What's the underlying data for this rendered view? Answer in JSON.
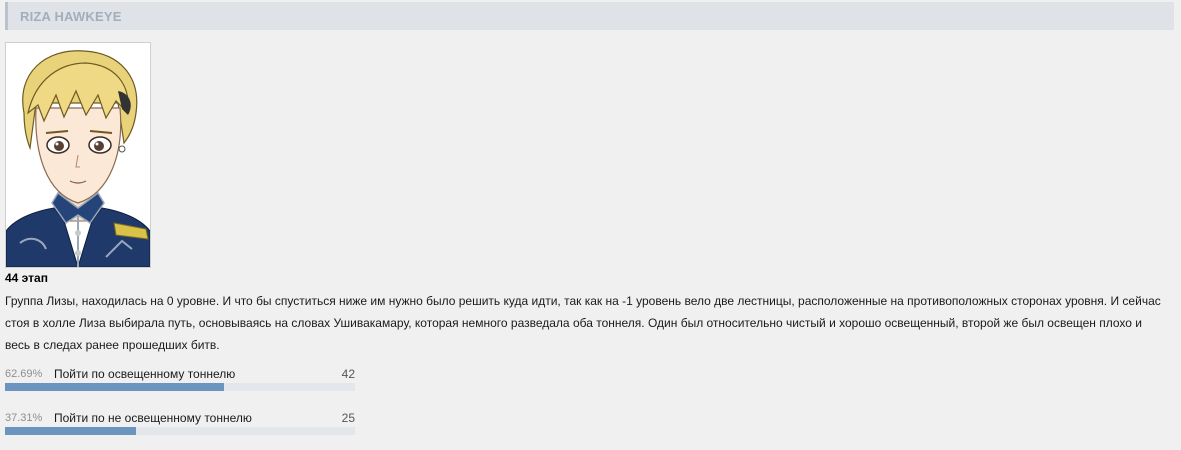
{
  "header": {
    "title": "RIZA HAWKEYE"
  },
  "post": {
    "stage": "44 этап",
    "description": "Группа Лизы, находилась на 0 уровне. И что бы спуститься ниже им нужно было решить куда идти, так как на -1 уровень вело две лестницы, расположенные на противоположных сторонах уровня. И сейчас стоя в холле Лиза выбирала путь, основываясь на словах Ушивакамару, которая немного разведала оба тоннеля. Один был относительно чистый и хорошо освещенный, второй же был освещен плохо и весь в следах ранее прошедших битв."
  },
  "poll": {
    "bar_color": "#6b95bf",
    "options": [
      {
        "percent": "62.69%",
        "label": "Пойти по освещенному тоннелю",
        "votes": "42",
        "fraction": 0.6269
      },
      {
        "percent": "37.31%",
        "label": "Пойти по не освещенному тоннелю",
        "votes": "25",
        "fraction": 0.3731
      }
    ]
  }
}
